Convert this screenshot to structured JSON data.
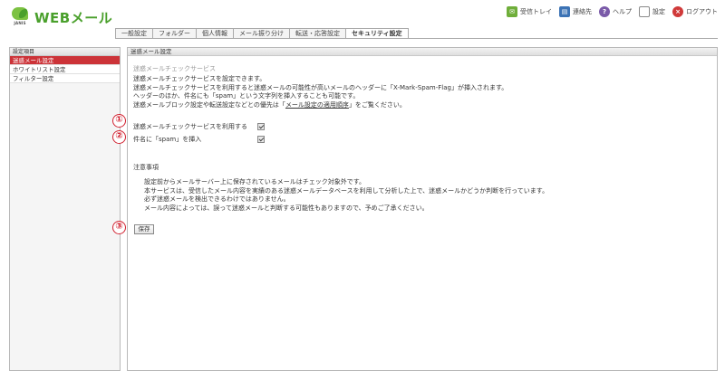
{
  "app": {
    "logo_small": "JANIS",
    "logo_text": "WEBメール"
  },
  "toolbar": {
    "items": [
      {
        "label": "受信トレイ",
        "icon": "inbox-icon"
      },
      {
        "label": "連絡先",
        "icon": "contacts-icon"
      },
      {
        "label": "ヘルプ",
        "icon": "help-icon"
      },
      {
        "label": "設定",
        "icon": "settings-icon"
      },
      {
        "label": "ログアウト",
        "icon": "logout-icon"
      }
    ]
  },
  "tabs": [
    {
      "label": "一般設定"
    },
    {
      "label": "フォルダー"
    },
    {
      "label": "個人情報"
    },
    {
      "label": "メール振り分け"
    },
    {
      "label": "転送・応答設定"
    },
    {
      "label": "セキュリティ設定",
      "active": true
    }
  ],
  "sidebar": {
    "title": "設定項目",
    "items": [
      {
        "label": "迷惑メール設定",
        "active": true
      },
      {
        "label": "ホワイトリスト設定"
      },
      {
        "label": "フィルター設定"
      }
    ]
  },
  "main": {
    "title": "迷惑メール設定",
    "section_title": "迷惑メールチェックサービス",
    "desc_lines": [
      "迷惑メールチェックサービスを設定できます。",
      "迷惑メールチェックサービスを利用すると迷惑メールの可能性が高いメールのヘッダーに「X-Mark-Spam-Flag」が挿入されます。",
      "ヘッダーのほか、件名にも「spam」という文字列を挿入することも可能です。"
    ],
    "desc_last_prefix": "迷惑メールブロック設定や転送設定などとの優先は「",
    "desc_last_link": "メール設定の適用順序",
    "desc_last_suffix": "」をご覧ください。",
    "options": [
      {
        "label": "迷惑メールチェックサービスを利用する",
        "checked": true
      },
      {
        "label": "件名に「spam」を挿入",
        "checked": true
      }
    ],
    "notes_title": "注意事項",
    "notes": [
      "設定前からメールサーバー上に保存されているメールはチェック対象外です。",
      "本サービスは、受信したメール内容を実績のある迷惑メールデータベースを利用して分析した上で、迷惑メールかどうか判断を行っています。",
      "必ず迷惑メールを検出できるわけではありません。",
      "メール内容によっては、誤って迷惑メールと判断する可能性もありますので、予めご了承ください。"
    ],
    "save_label": "保存"
  },
  "callouts": [
    "①",
    "②",
    "③"
  ],
  "colors": {
    "brand_green": "#4aa02c",
    "active_red": "#cc3338",
    "callout_red": "#d1202f"
  }
}
